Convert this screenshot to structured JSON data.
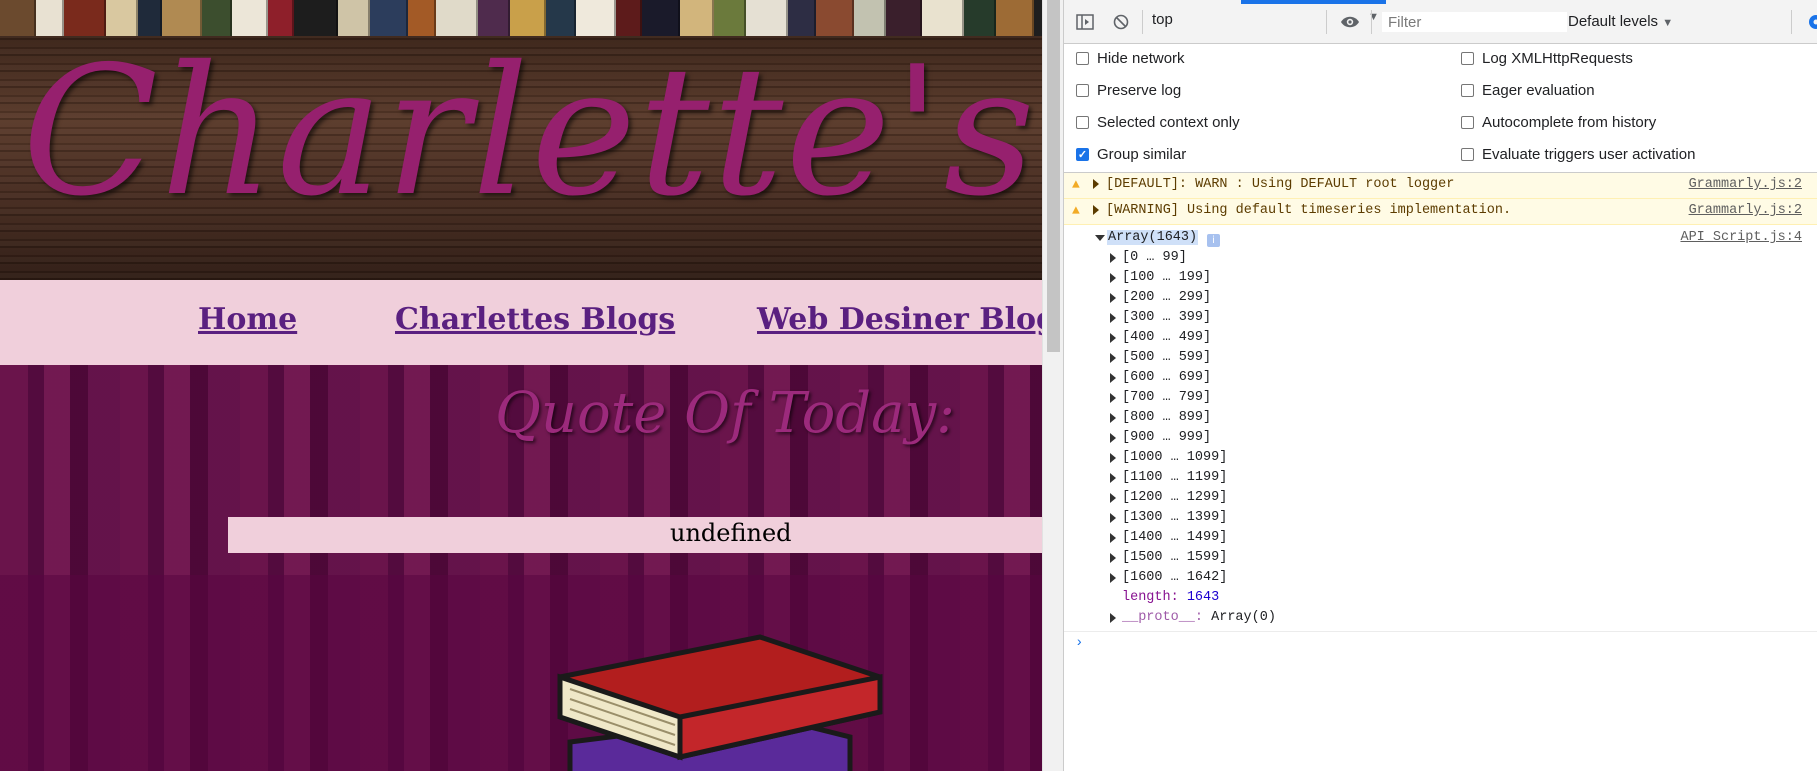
{
  "page": {
    "site_title": "Charlette's W",
    "nav": [
      "Home",
      "Charlettes Blogs",
      "Web Desiner Blog"
    ],
    "quote_heading": "Quote Of Today:",
    "quote_text": "undefined"
  },
  "devtools": {
    "toolbar": {
      "context": "top",
      "filter_placeholder": "Filter",
      "levels": "Default levels"
    },
    "settings": {
      "left": [
        {
          "label": "Hide network",
          "checked": false
        },
        {
          "label": "Preserve log",
          "checked": false
        },
        {
          "label": "Selected context only",
          "checked": false
        },
        {
          "label": "Group similar",
          "checked": true
        }
      ],
      "right": [
        {
          "label": "Log XMLHttpRequests",
          "checked": false
        },
        {
          "label": "Eager evaluation",
          "checked": false
        },
        {
          "label": "Autocomplete from history",
          "checked": false
        },
        {
          "label": "Evaluate triggers user activation",
          "checked": false
        }
      ]
    },
    "console": {
      "warnings": [
        {
          "message": "[DEFAULT]: WARN : Using DEFAULT root logger",
          "source": "Grammarly.js:2"
        },
        {
          "message": "[WARNING] Using default timeseries implementation.",
          "source": "Grammarly.js:2"
        }
      ],
      "log": {
        "label": "Array(1643)",
        "info": "i",
        "source": "API_Script.js:4",
        "ranges": [
          "[0 … 99]",
          "[100 … 199]",
          "[200 … 299]",
          "[300 … 399]",
          "[400 … 499]",
          "[500 … 599]",
          "[600 … 699]",
          "[700 … 799]",
          "[800 … 899]",
          "[900 … 999]",
          "[1000 … 1099]",
          "[1100 … 1199]",
          "[1200 … 1299]",
          "[1300 … 1399]",
          "[1400 … 1499]",
          "[1500 … 1599]",
          "[1600 … 1642]"
        ],
        "length_key": "length",
        "length_value": "1643",
        "proto_key": "__proto__",
        "proto_value": "Array(0)"
      },
      "prompt": "›"
    }
  },
  "colors": {
    "accent": "#1a73e8",
    "title": "#96206e",
    "nav_bg": "#f0cfdb",
    "nav_link": "#5a2080"
  }
}
